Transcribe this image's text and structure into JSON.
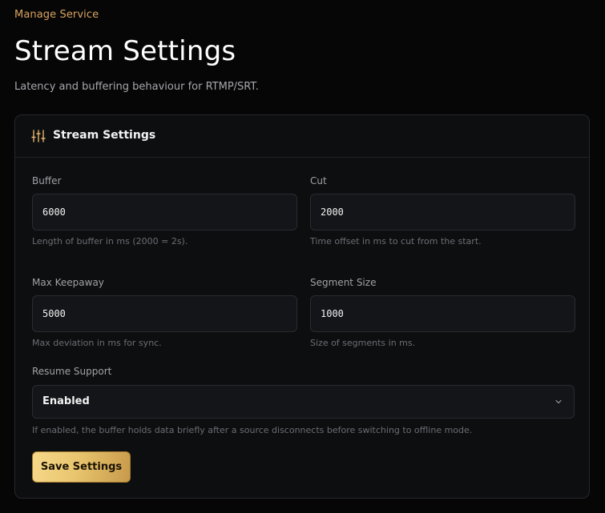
{
  "breadcrumb": "Manage Service",
  "page": {
    "title": "Stream Settings",
    "subtitle": "Latency and buffering behaviour for RTMP/SRT."
  },
  "card": {
    "title": "Stream Settings",
    "icon": "sliders-icon"
  },
  "fields": {
    "buffer": {
      "label": "Buffer",
      "value": "6000",
      "help": "Length of buffer in ms (2000 = 2s)."
    },
    "cut": {
      "label": "Cut",
      "value": "2000",
      "help": "Time offset in ms to cut from the start."
    },
    "max_keepaway": {
      "label": "Max Keepaway",
      "value": "5000",
      "help": "Max deviation in ms for sync."
    },
    "segment_size": {
      "label": "Segment Size",
      "value": "1000",
      "help": "Size of segments in ms."
    },
    "resume_support": {
      "label": "Resume Support",
      "value": "Enabled",
      "help": "If enabled, the buffer holds data briefly after a source disconnects before switching to offline mode."
    }
  },
  "actions": {
    "save_label": "Save Settings"
  },
  "colors": {
    "accent": "#d9a35e",
    "button_gradient_start": "#f6d98a",
    "button_gradient_end": "#c79a4a",
    "background": "#060607",
    "card": "#0d0e10"
  }
}
